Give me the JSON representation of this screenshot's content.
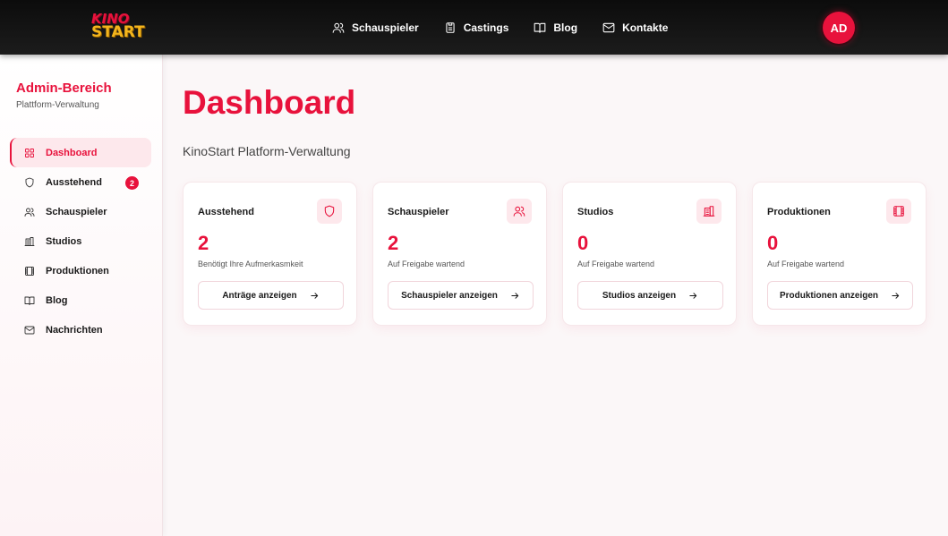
{
  "logo": {
    "line1": "KINO",
    "line2": "START"
  },
  "nav": {
    "items": [
      {
        "label": "Schauspieler",
        "icon": "users-icon"
      },
      {
        "label": "Castings",
        "icon": "clipboard-icon"
      },
      {
        "label": "Blog",
        "icon": "book-icon"
      },
      {
        "label": "Kontakte",
        "icon": "mail-icon"
      }
    ],
    "avatar": "AD"
  },
  "sidebar": {
    "title": "Admin-Bereich",
    "subtitle": "Plattform-Verwaltung",
    "items": [
      {
        "label": "Dashboard",
        "icon": "grid-icon",
        "active": true
      },
      {
        "label": "Ausstehend",
        "icon": "shield-icon",
        "badge": "2"
      },
      {
        "label": "Schauspieler",
        "icon": "users-icon"
      },
      {
        "label": "Studios",
        "icon": "building-icon"
      },
      {
        "label": "Produktionen",
        "icon": "film-icon"
      },
      {
        "label": "Blog",
        "icon": "book-icon"
      },
      {
        "label": "Nachrichten",
        "icon": "mail-icon"
      }
    ]
  },
  "main": {
    "title": "Dashboard",
    "subtitle": "KinoStart Platform-Verwaltung",
    "cards": [
      {
        "title": "Ausstehend",
        "value": "2",
        "desc": "Benötigt Ihre Aufmerkasmkeit",
        "button": "Anträge anzeigen",
        "icon": "shield-icon"
      },
      {
        "title": "Schauspieler",
        "value": "2",
        "desc": "Auf Freigabe wartend",
        "button": "Schauspieler anzeigen",
        "icon": "users-icon"
      },
      {
        "title": "Studios",
        "value": "0",
        "desc": "Auf Freigabe wartend",
        "button": "Studios anzeigen",
        "icon": "building-icon"
      },
      {
        "title": "Produktionen",
        "value": "0",
        "desc": "Auf Freigabe wartend",
        "button": "Produktionen anzeigen",
        "icon": "film-icon"
      }
    ]
  },
  "colors": {
    "accent": "#e8123c",
    "topbar": "#111111",
    "logo_gold": "#f4b51c"
  }
}
